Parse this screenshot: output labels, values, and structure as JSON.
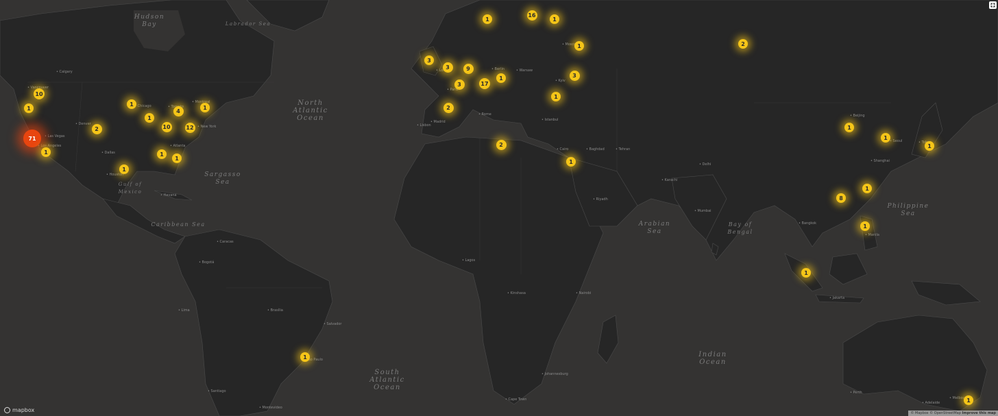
{
  "map": {
    "logo_text": "mapbox",
    "attribution": "© Mapbox © OpenStreetMap",
    "attribution_link": "Improve this map",
    "colors": {
      "water": "#343332",
      "land": "#262626",
      "border": "#4b4b4b",
      "marker": "#f5c518",
      "marker_hot": "#e8450f"
    }
  },
  "water_labels": [
    {
      "text": "Hudson\nBay"
    },
    {
      "text": "North\nAtlantic\nOcean"
    },
    {
      "text": "Sargasso\nSea"
    },
    {
      "text": "South\nAtlantic\nOcean"
    },
    {
      "text": "Arabian\nSea"
    },
    {
      "text": "Bay of\nBengal"
    },
    {
      "text": "Indian\nOcean"
    },
    {
      "text": "Philippine\nSea"
    },
    {
      "text": "Gulf of\nMexico"
    },
    {
      "text": "Caribbean Sea"
    },
    {
      "text": "Labrador Sea"
    }
  ],
  "cities": [
    "New York",
    "Chicago",
    "Toronto",
    "Montreal",
    "Atlanta",
    "Houston",
    "Dallas",
    "Los Angeles",
    "Las Vegas",
    "Denver",
    "Calgary",
    "Vancouver",
    "Havana",
    "Caracas",
    "Bogotá",
    "Lima",
    "Brasília",
    "Salvador",
    "São Paulo",
    "Montevideo",
    "Santiago",
    "London",
    "Paris",
    "Madrid",
    "Lisbon",
    "Rome",
    "Berlin",
    "Warsaw",
    "Kyiv",
    "Moscow",
    "Istanbul",
    "Cairo",
    "Lagos",
    "Nairobi",
    "Johannesburg",
    "Cape Town",
    "Kinshasa",
    "Tehran",
    "Baghdad",
    "Riyadh",
    "Karachi",
    "Mumbai",
    "Delhi",
    "Bangkok",
    "Jakarta",
    "Manila",
    "Beijing",
    "Shanghai",
    "Seoul",
    "Tokyo",
    "Perth",
    "Adelaide",
    "Melbourne"
  ],
  "clusters": [
    {
      "count": "71",
      "hot": true
    },
    {
      "count": "10"
    },
    {
      "count": "1"
    },
    {
      "count": "1"
    },
    {
      "count": "2"
    },
    {
      "count": "1"
    },
    {
      "count": "1"
    },
    {
      "count": "4"
    },
    {
      "count": "1"
    },
    {
      "count": "10"
    },
    {
      "count": "12"
    },
    {
      "count": "1"
    },
    {
      "count": "1"
    },
    {
      "count": "1"
    },
    {
      "count": "1"
    },
    {
      "count": "3"
    },
    {
      "count": "3"
    },
    {
      "count": "9"
    },
    {
      "count": "3"
    },
    {
      "count": "17"
    },
    {
      "count": "1"
    },
    {
      "count": "2"
    },
    {
      "count": "2"
    },
    {
      "count": "1"
    },
    {
      "count": "16"
    },
    {
      "count": "1"
    },
    {
      "count": "1"
    },
    {
      "count": "3"
    },
    {
      "count": "1"
    },
    {
      "count": "1"
    },
    {
      "count": "2"
    },
    {
      "count": "1"
    },
    {
      "count": "1"
    },
    {
      "count": "1"
    },
    {
      "count": "1"
    },
    {
      "count": "8"
    },
    {
      "count": "1"
    },
    {
      "count": "1"
    },
    {
      "count": "1"
    }
  ]
}
